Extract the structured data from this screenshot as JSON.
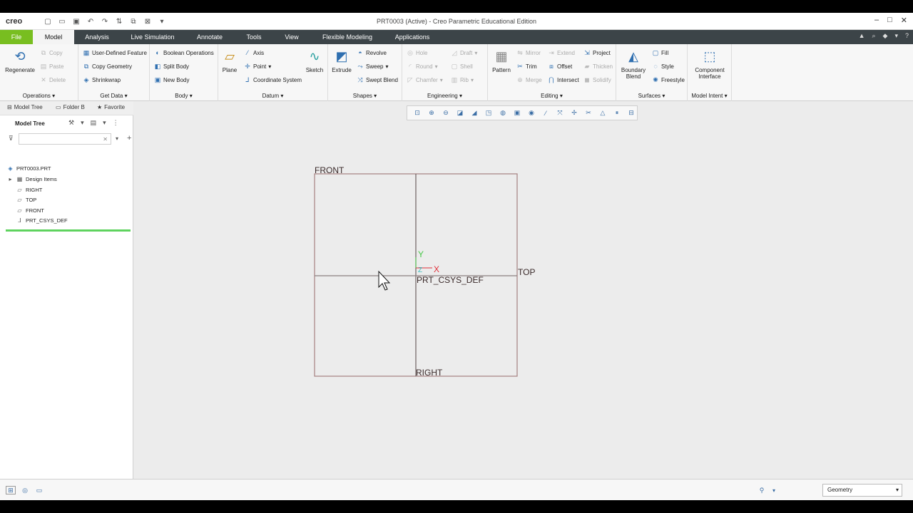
{
  "titlebar": {
    "logo": "creo",
    "title": "PRT0003 (Active) - Creo Parametric Educational Edition",
    "qat": [
      "new-icon",
      "open-icon",
      "save-icon",
      "undo-icon",
      "redo-icon",
      "regenerate-icon",
      "windows-icon",
      "close-window-icon",
      "customize-icon"
    ],
    "window_controls": [
      "minimize",
      "maximize",
      "close"
    ]
  },
  "tabs": [
    "File",
    "Model",
    "Analysis",
    "Live Simulation",
    "Annotate",
    "Tools",
    "View",
    "Flexible Modeling",
    "Applications"
  ],
  "active_tab": "Model",
  "ribbon": {
    "operations": {
      "regenerate": "Regenerate",
      "copy": "Copy",
      "paste": "Paste",
      "delete": "Delete",
      "label": "Operations"
    },
    "get_data": {
      "udf": "User-Defined Feature",
      "copy_geometry": "Copy Geometry",
      "shrinkwrap": "Shrinkwrap",
      "label": "Get Data"
    },
    "body": {
      "boolean": "Boolean Operations",
      "split": "Split Body",
      "new": "New Body",
      "label": "Body"
    },
    "datum": {
      "plane": "Plane",
      "axis": "Axis",
      "point": "Point",
      "csys": "Coordinate System",
      "sketch": "Sketch",
      "label": "Datum"
    },
    "shapes": {
      "extrude": "Extrude",
      "revolve": "Revolve",
      "sweep": "Sweep",
      "swept_blend": "Swept Blend",
      "label": "Shapes"
    },
    "engineering": {
      "hole": "Hole",
      "round": "Round",
      "chamfer": "Chamfer",
      "draft": "Draft",
      "shell": "Shell",
      "rib": "Rib",
      "label": "Engineering"
    },
    "editing": {
      "pattern": "Pattern",
      "mirror": "Mirror",
      "trim": "Trim",
      "merge": "Merge",
      "extend": "Extend",
      "offset": "Offset",
      "intersect": "Intersect",
      "project": "Project",
      "thicken": "Thicken",
      "solidify": "Solidify",
      "label": "Editing"
    },
    "surfaces": {
      "boundary_blend": "Boundary Blend",
      "fill": "Fill",
      "style": "Style",
      "freestyle": "Freestyle",
      "label": "Surfaces"
    },
    "model_intent": {
      "component_interface": "Component Interface",
      "label": "Model Intent"
    }
  },
  "leftpanel": {
    "tabs": [
      "Model Tree",
      "Folder B",
      "Favorite"
    ],
    "tree_title": "Model Tree",
    "tree_items": [
      "PRT0003.PRT",
      "Design Items",
      "RIGHT",
      "TOP",
      "FRONT",
      "PRT_CSYS_DEF"
    ]
  },
  "graphics": {
    "plane_labels": {
      "front": "FRONT",
      "top": "TOP",
      "right": "RIGHT",
      "csys": "PRT_CSYS_DEF"
    },
    "axis_labels": {
      "x": "X",
      "y": "Y",
      "z": "Z"
    },
    "colors": {
      "plane_edge": "#b08a8a",
      "x_axis": "#e0303a",
      "y_axis": "#48c848",
      "z_axis": "#40c0c0"
    }
  },
  "statusbar": {
    "selection_filter": "Geometry"
  },
  "colors": {
    "file_tab": "#78be20",
    "tabbar_bg": "#3c4448",
    "accent_icon": "#2f6fb0",
    "insert_indicator": "#5ed35e"
  }
}
